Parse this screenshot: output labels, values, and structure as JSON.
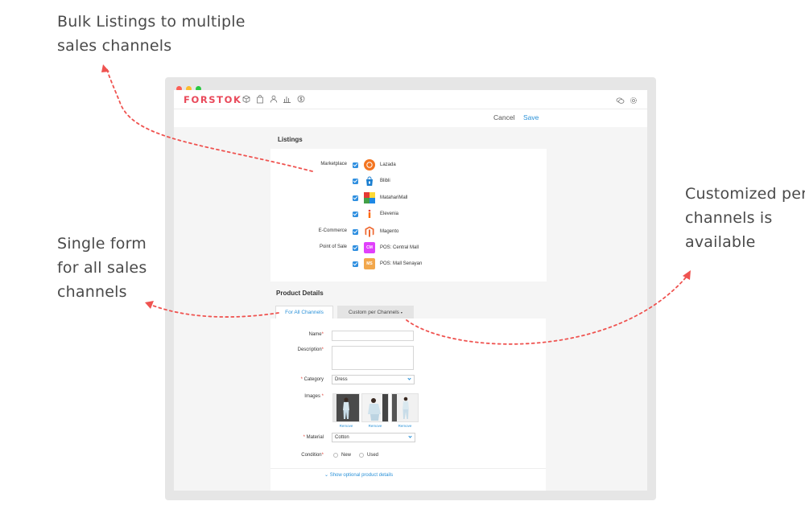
{
  "callouts": {
    "bulk": [
      "Bulk Listings to multiple",
      "sales channels"
    ],
    "single": [
      "Single form",
      "for all sales",
      "channels"
    ],
    "custom": [
      "Customized per",
      "channels is",
      "available"
    ]
  },
  "app": {
    "brand": "FORSTOK",
    "actions": {
      "cancel": "Cancel",
      "save": "Save"
    }
  },
  "listings": {
    "title": "Listings",
    "groups": {
      "marketplace": "Marketplace",
      "ecommerce": "E-Commerce",
      "pos": "Point of Sale"
    },
    "channels": [
      {
        "name": "Lazada",
        "checked": true,
        "color": "#f37521",
        "icon": "lazada-logo-icon",
        "mark": ""
      },
      {
        "name": "Blibli",
        "checked": true,
        "color": "#1a7ed0",
        "icon": "blibli-logo-icon",
        "mark": ""
      },
      {
        "name": "MatahariMall",
        "checked": true,
        "color": "#e53935",
        "icon": "mataharimall-logo-icon",
        "mark": ""
      },
      {
        "name": "Elevenia",
        "checked": true,
        "color": "#ff6a00",
        "icon": "elevenia-logo-icon",
        "mark": ""
      },
      {
        "name": "Magento",
        "checked": true,
        "color": "#ee672f",
        "icon": "magento-logo-icon",
        "mark": ""
      },
      {
        "name": "POS: Central Mall",
        "checked": true,
        "color": "#e040fb",
        "icon": "pos-logo-icon",
        "mark": "CM"
      },
      {
        "name": "POS: Mall Senayan",
        "checked": true,
        "color": "#f2a74b",
        "icon": "pos-logo-icon",
        "mark": "MS"
      }
    ]
  },
  "product_details": {
    "title": "Product Details",
    "tabs": {
      "all": "For All Channels",
      "custom": "Custom per Channels"
    },
    "fields": {
      "name": "Name",
      "description": "Description",
      "category": "Category",
      "category_value": "Dress",
      "images": "Images",
      "remove": "Remove",
      "material": "Material",
      "material_value": "Cotton",
      "condition": "Condition",
      "condition_new": "New",
      "condition_used": "Used",
      "required_mark": "*"
    },
    "optional_link": "Show optional product details"
  }
}
